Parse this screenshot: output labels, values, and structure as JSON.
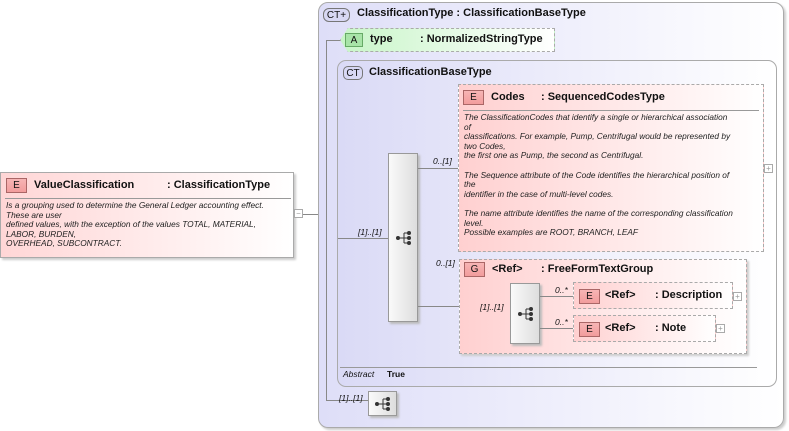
{
  "root": {
    "badge": "E",
    "name": "ValueClassification",
    "type": ": ClassificationType",
    "description": "Is a grouping used to determine the General Ledger accounting effect.\nThese are user\ndefined values, with the exception of the values TOTAL, MATERIAL,\nLABOR, BURDEN,\nOVERHEAD, SUBCONTRACT.",
    "collapse": "−"
  },
  "complex_type": {
    "badge": "CT+",
    "title": "ClassificationType : ClassificationBaseType",
    "attribute": {
      "badge": "A",
      "name": "type",
      "type": ": NormalizedStringType"
    },
    "sequence_card": "[1]..[1]"
  },
  "base_type": {
    "badge": "CT",
    "title": "ClassificationBaseType",
    "sequence_card": "[1]..[1]",
    "codes": {
      "badge": "E",
      "name": "Codes",
      "type": ": SequencedCodesType",
      "card": "0..[1]",
      "description": "The ClassificationCodes that identify a single or hierarchical association\nof\nclassifications. For example, Pump, Centrifugal would be represented by\ntwo Codes,\nthe first one as Pump, the second as Centrifugal.\n\nThe Sequence attribute of the Code identifies the hierarchical position of\nthe\nidentifier in the case of multi-level codes.\n\nThe name attribute identifies the name of the corresponding classification\nlevel.\nPossible examples are ROOT, BRANCH, LEAF"
    },
    "group": {
      "badge": "G",
      "name": "<Ref>",
      "type": ": FreeFormTextGroup",
      "card": "0..[1]",
      "sequence_card": "[1]..[1]",
      "items": [
        {
          "badge": "E",
          "name": "<Ref>",
          "type": ": Description",
          "card": "0..*"
        },
        {
          "badge": "E",
          "name": "<Ref>",
          "type": ": Note",
          "card": "0..*"
        }
      ]
    },
    "abstract_label": "Abstract",
    "abstract_value": "True"
  },
  "plus": "+"
}
